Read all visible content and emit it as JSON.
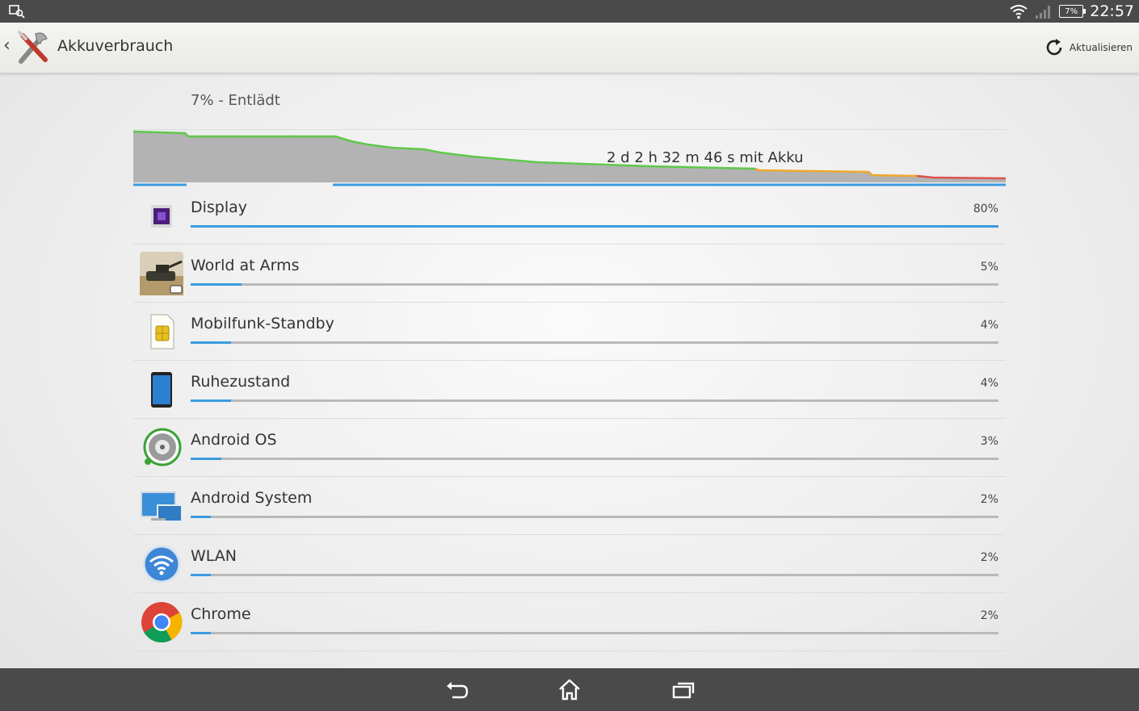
{
  "status_bar": {
    "time": "22:57",
    "battery_label": "7%"
  },
  "action_bar": {
    "title": "Akkuverbrauch",
    "refresh_label": "Aktualisieren"
  },
  "battery": {
    "status": "7% - Entlädt",
    "duration": "2 d 2 h 32 m 46 s mit Akku"
  },
  "usage_list": [
    {
      "name": "Display",
      "percent_label": "80%",
      "percent": 80,
      "icon": "display-icon"
    },
    {
      "name": "World at Arms",
      "percent_label": "5%",
      "percent": 5,
      "icon": "world-at-arms-icon"
    },
    {
      "name": "Mobilfunk-Standby",
      "percent_label": "4%",
      "percent": 4,
      "icon": "sim-card-icon"
    },
    {
      "name": "Ruhezustand",
      "percent_label": "4%",
      "percent": 4,
      "icon": "phone-idle-icon"
    },
    {
      "name": "Android OS",
      "percent_label": "3%",
      "percent": 3,
      "icon": "android-os-icon"
    },
    {
      "name": "Android System",
      "percent_label": "2%",
      "percent": 2,
      "icon": "android-system-icon"
    },
    {
      "name": "WLAN",
      "percent_label": "2%",
      "percent": 2,
      "icon": "wifi-icon"
    },
    {
      "name": "Chrome",
      "percent_label": "2%",
      "percent": 2,
      "icon": "chrome-icon"
    }
  ],
  "colors": {
    "accent": "#3b9be0",
    "graph_green": "#5fc94a",
    "graph_orange": "#f0a830",
    "graph_red": "#e05050"
  }
}
